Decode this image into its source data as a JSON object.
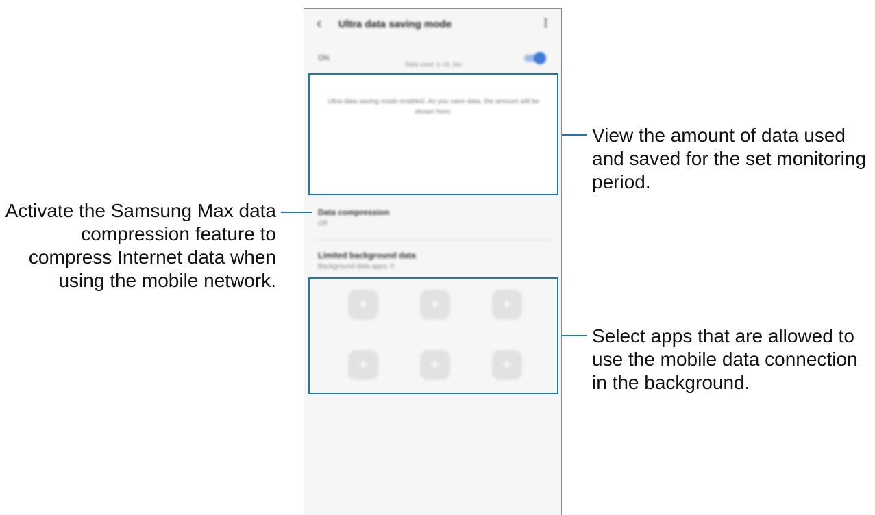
{
  "screen": {
    "title": "Ultra data saving mode",
    "switch_label": "ON",
    "switch_on": true,
    "usage_message": "Ultra data saving mode enabled. As you save data, the amount will be shown here.",
    "usage_period": "Data used: 1–31 Jan",
    "data_compression": {
      "title": "Data compression",
      "status": "Off"
    },
    "limited_background": {
      "title": "Limited background data",
      "subtitle": "Background data apps: 0"
    },
    "app_slots": [
      "+",
      "+",
      "+",
      "+",
      "+",
      "+"
    ]
  },
  "callouts": {
    "usage": [
      "View the amount of data used",
      "and saved for the set monitoring",
      "period."
    ],
    "compression": [
      "Activate the Samsung Max data",
      "compression feature to",
      "compress Internet data when",
      "using the mobile network."
    ],
    "apps": [
      "Select apps that are allowed to",
      "use the mobile data connection",
      "in the background."
    ]
  },
  "colors": {
    "highlight": "#1a7ab7",
    "toggle": "#3e7bd6"
  }
}
